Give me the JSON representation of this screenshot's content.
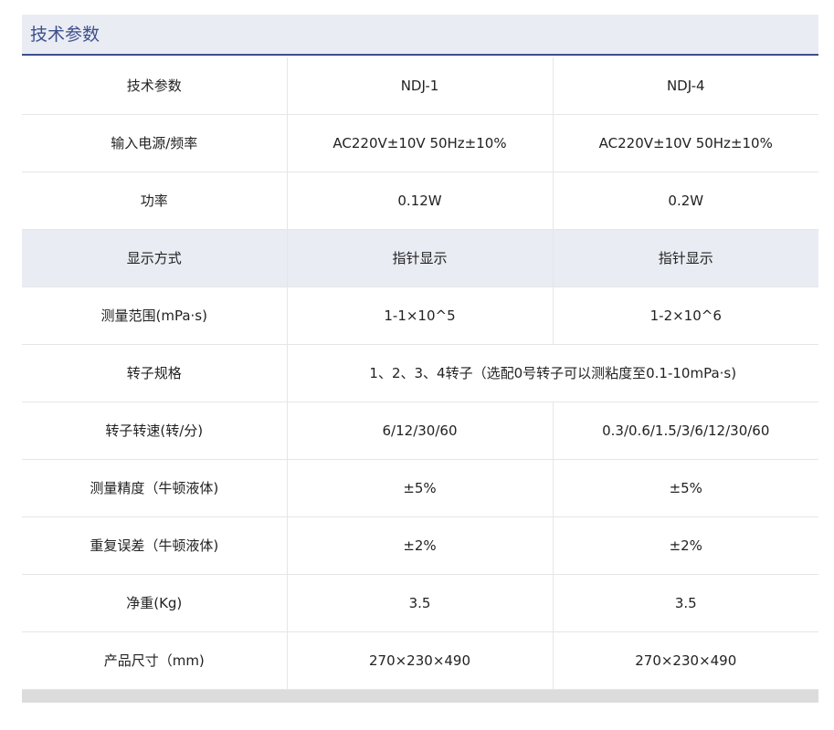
{
  "section": {
    "title": "技术参数"
  },
  "table": {
    "rows": [
      {
        "label": "技术参数",
        "cells": [
          "NDJ-1",
          "NDJ-4"
        ],
        "merged": false,
        "shaded": false
      },
      {
        "label": "输入电源/频率",
        "cells": [
          "AC220V±10V 50Hz±10%",
          "AC220V±10V 50Hz±10%"
        ],
        "merged": false,
        "shaded": false
      },
      {
        "label": "功率",
        "cells": [
          "0.12W",
          "0.2W"
        ],
        "merged": false,
        "shaded": false
      },
      {
        "label": "显示方式",
        "cells": [
          "指针显示",
          "指针显示"
        ],
        "merged": false,
        "shaded": true
      },
      {
        "label": "测量范围(mPa·s)",
        "cells": [
          "1-1×10^5",
          "1-2×10^6"
        ],
        "merged": false,
        "shaded": false
      },
      {
        "label": "转子规格",
        "cells": [
          "1、2、3、4转子（选配0号转子可以测粘度至0.1-10mPa·s)"
        ],
        "merged": true,
        "shaded": false
      },
      {
        "label": "转子转速(转/分)",
        "cells": [
          "6/12/30/60",
          "0.3/0.6/1.5/3/6/12/30/60"
        ],
        "merged": false,
        "shaded": false
      },
      {
        "label": "测量精度（牛顿液体)",
        "cells": [
          "±5%",
          "±5%"
        ],
        "merged": false,
        "shaded": false
      },
      {
        "label": "重复误差（牛顿液体)",
        "cells": [
          "±2%",
          "±2%"
        ],
        "merged": false,
        "shaded": false
      },
      {
        "label": "净重(Kg)",
        "cells": [
          "3.5",
          "3.5"
        ],
        "merged": false,
        "shaded": false
      },
      {
        "label": "产品尺寸（mm)",
        "cells": [
          "270×230×490",
          "270×230×490"
        ],
        "merged": false,
        "shaded": false
      }
    ]
  }
}
